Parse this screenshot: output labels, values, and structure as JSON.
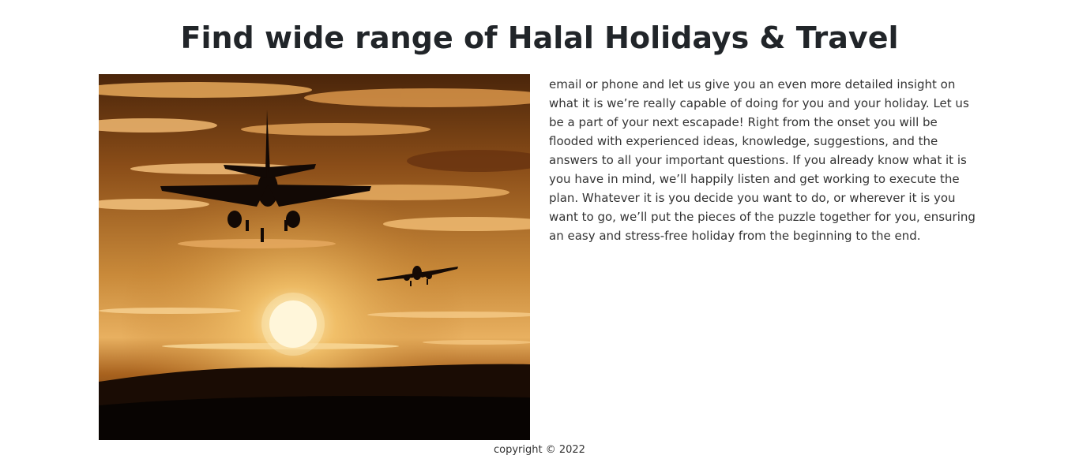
{
  "page": {
    "title": "Find wide range of Halal Holidays & Travel"
  },
  "hero_image": {
    "alt": "",
    "icon": "airplane-sunset-photo"
  },
  "intro": {
    "text": "email or phone and let us give you an even more detailed insight on what it is we’re really capable of doing for you and your holiday. Let us be a part of your next escapade! Right from the onset you will be flooded with experienced ideas, knowledge, suggestions, and the answers to all your important questions. If you already know what it is you have in mind, we’ll happily listen and get working to execute the plan. Whatever it is you decide you want to do, or wherever it is you want to go, we’ll put the pieces of the puzzle together for you, ensuring an easy and stress-free holiday from the beginning to the end."
  },
  "footer": {
    "copyright": "copyright © 2022"
  },
  "colors": {
    "sky_top": "#5a2e0c",
    "sky_mid": "#c77a2a",
    "sky_glow": "#f6c97a",
    "sun": "#fff7dc",
    "ground": "#0b0603"
  }
}
